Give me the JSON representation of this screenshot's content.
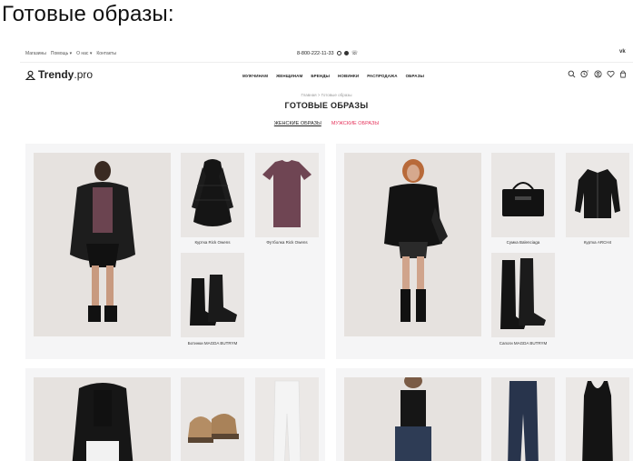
{
  "caption": "Готовые образы:",
  "topbar": {
    "links": [
      "Магазины",
      "Помощь ▾",
      "О нас ▾",
      "Контакты"
    ],
    "phone": "8-800-222-11-33",
    "social": "vk"
  },
  "header": {
    "logo_main": "Trendy",
    "logo_suffix": ".pro",
    "nav": [
      "МУЖЧИНАМ",
      "ЖЕНЩИНАМ",
      "БРЕНДЫ",
      "НОВИНКИ",
      "РАСПРОДАЖА",
      "ОБРАЗЫ"
    ],
    "cart_count": "0"
  },
  "breadcrumb": "Главная  >  Готовые образы",
  "page_title": "ГОТОВЫЕ ОБРАЗЫ",
  "tabs": {
    "women": "ЖЕНСКИЕ ОБРАЗЫ",
    "men": "МУЖСКИЕ ОБРАЗЫ"
  },
  "looks": [
    {
      "items": [
        {
          "label": "Куртка Rick Owens"
        },
        {
          "label": "Футболка Rick Owens"
        },
        {
          "label": "Ботинки MAGDA BUTRYM"
        }
      ]
    },
    {
      "items": [
        {
          "label": "Сумка Balenciaga"
        },
        {
          "label": "Куртка ARCH4"
        },
        {
          "label": "Сапоги MAGDA BUTRYM"
        }
      ]
    }
  ],
  "colors": {
    "accent": "#e5335b",
    "card_bg": "#f5f5f6",
    "photo_bg": "#e8e5e3"
  }
}
